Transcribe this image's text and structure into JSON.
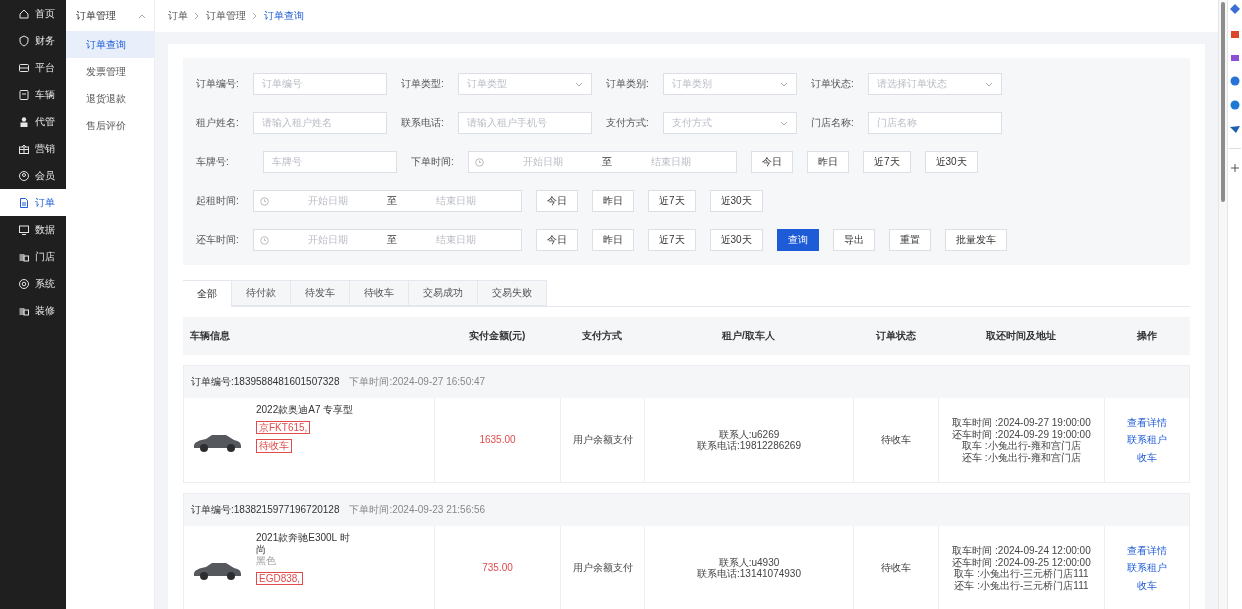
{
  "nav": {
    "items": [
      {
        "label": "首页",
        "selected": false
      },
      {
        "label": "财务",
        "selected": false
      },
      {
        "label": "平台",
        "selected": false
      },
      {
        "label": "车辆",
        "selected": false
      },
      {
        "label": "代管",
        "selected": false
      },
      {
        "label": "营销",
        "selected": false
      },
      {
        "label": "会员",
        "selected": false
      },
      {
        "label": "订单",
        "selected": true
      },
      {
        "label": "数据",
        "selected": false
      },
      {
        "label": "门店",
        "selected": false
      },
      {
        "label": "系统",
        "selected": false
      },
      {
        "label": "装修",
        "selected": false
      }
    ]
  },
  "submenu": {
    "title": "订单管理",
    "expanded": true,
    "items": [
      {
        "label": "订单查询",
        "selected": true
      },
      {
        "label": "发票管理",
        "selected": false
      },
      {
        "label": "退货退款",
        "selected": false
      },
      {
        "label": "售后评价",
        "selected": false
      }
    ]
  },
  "breadcrumb": [
    "订单",
    "订单管理",
    "订单查询"
  ],
  "filters": {
    "rows": [
      [
        {
          "kind": "text",
          "label": "订单编号:",
          "placeholder": "订单编号"
        },
        {
          "kind": "select",
          "label": "订单类型:",
          "placeholder": "订单类型"
        },
        {
          "kind": "select",
          "label": "订单类别:",
          "placeholder": "订单类别"
        },
        {
          "kind": "select",
          "label": "订单状态:",
          "placeholder": "请选择订单状态"
        }
      ],
      [
        {
          "kind": "text",
          "label": "租户姓名:",
          "placeholder": "请输入租户姓名"
        },
        {
          "kind": "text",
          "label": "联系电话:",
          "placeholder": "请输入租户手机号"
        },
        {
          "kind": "select",
          "label": "支付方式:",
          "placeholder": "支付方式"
        },
        {
          "kind": "text",
          "label": "门店名称:",
          "placeholder": "门店名称"
        }
      ],
      [
        {
          "kind": "text",
          "label": "车牌号:",
          "placeholder": "车牌号"
        },
        {
          "kind": "daterange",
          "label": "下单时间:",
          "start": "开始日期",
          "separator": "至",
          "end": "结束日期"
        },
        {
          "kind": "button",
          "label": "今日",
          "primary": false
        },
        {
          "kind": "button",
          "label": "昨日",
          "primary": false
        },
        {
          "kind": "button",
          "label": "近7天",
          "primary": false
        },
        {
          "kind": "button",
          "label": "近30天",
          "primary": false
        }
      ],
      [
        {
          "kind": "daterange",
          "label": "起租时间:",
          "start": "开始日期",
          "separator": "至",
          "end": "结束日期"
        },
        {
          "kind": "button",
          "label": "今日",
          "primary": false
        },
        {
          "kind": "button",
          "label": "昨日",
          "primary": false
        },
        {
          "kind": "button",
          "label": "近7天",
          "primary": false
        },
        {
          "kind": "button",
          "label": "近30天",
          "primary": false
        }
      ],
      [
        {
          "kind": "daterange",
          "label": "还车时间:",
          "start": "开始日期",
          "separator": "至",
          "end": "结束日期"
        },
        {
          "kind": "button",
          "label": "今日",
          "primary": false
        },
        {
          "kind": "button",
          "label": "昨日",
          "primary": false
        },
        {
          "kind": "button",
          "label": "近7天",
          "primary": false
        },
        {
          "kind": "button",
          "label": "近30天",
          "primary": false
        },
        {
          "kind": "button",
          "label": "查询",
          "primary": true
        },
        {
          "kind": "button",
          "label": "导出",
          "primary": false
        },
        {
          "kind": "button",
          "label": "重置",
          "primary": false
        },
        {
          "kind": "button",
          "label": "批量发车",
          "primary": false
        }
      ]
    ]
  },
  "tabs": [
    {
      "label": "全部",
      "selected": true
    },
    {
      "label": "待付款",
      "selected": false
    },
    {
      "label": "待发车",
      "selected": false
    },
    {
      "label": "待收车",
      "selected": false
    },
    {
      "label": "交易成功",
      "selected": false
    },
    {
      "label": "交易失败",
      "selected": false
    }
  ],
  "table": {
    "columns": [
      "车辆信息",
      "实付金额(元)",
      "支付方式",
      "租户/取车人",
      "订单状态",
      "取还时间及地址",
      "操作"
    ],
    "orders": [
      {
        "order_no": "订单编号:1839588481601507328",
        "order_time": "下单时间:2024-09-27 16:50:47",
        "vehicle_name": "2022款奥迪A7 专享型",
        "plate": "京FKT615,",
        "status_tag": "待收车",
        "amount": "1635.00",
        "payment": "用户余额支付",
        "contact": "联系人:u6269",
        "phone": "联系电话:19812286269",
        "status": "待收车",
        "details": [
          "取车时间 :2024-09-27 19:00:00",
          "还车时间 :2024-09-29 19:00:00",
          "取车 :小兔出行-雍和宫门店",
          "还车 :小兔出行-雍和宫门店"
        ],
        "actions": [
          "查看详情",
          "联系租户",
          "收车"
        ]
      },
      {
        "order_no": "订单编号:1838215977196720128",
        "order_time": "下单时间:2024-09-23 21:56:56",
        "vehicle_name": "2021款奔驰E300L 时尚",
        "vehicle_color": "黑色",
        "plate": "EGD838,",
        "amount": "735.00",
        "payment": "用户余额支付",
        "contact": "联系人:u4930",
        "phone": "联系电话:13141074930",
        "status": "待收车",
        "details": [
          "取车时间 :2024-09-24 12:00:00",
          "还车时间 :2024-09-25 12:00:00",
          "取车 :小兔出行-三元桥门店111",
          "还车 :小兔出行-三元桥门店111"
        ],
        "actions": [
          "查看详情",
          "联系租户",
          "收车"
        ]
      }
    ]
  }
}
